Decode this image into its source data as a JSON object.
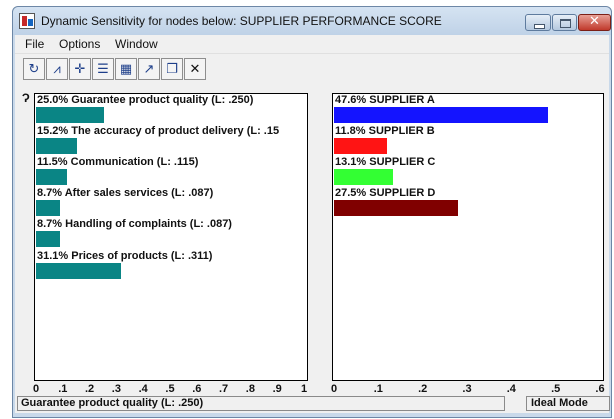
{
  "window": {
    "title": "Dynamic Sensitivity for nodes below: SUPPLIER PERFORMANCE SCORE",
    "close_glyph": "✕"
  },
  "menu": [
    "File",
    "Options",
    "Window"
  ],
  "toolbar": {
    "icons": [
      "refresh-icon",
      "line-graph-icon",
      "gradient-icon",
      "stacked-bars-icon",
      "grid-chart-icon",
      "arrow-icon",
      "windows-icon",
      "close-icon"
    ],
    "glyphs": [
      "↻",
      "⩘",
      "✛",
      "☰",
      "▦",
      "↗",
      "❐",
      "✕"
    ]
  },
  "left_mark": "Ɂ",
  "chart_data": [
    {
      "type": "bar",
      "orientation": "horizontal",
      "categories": [
        "25.0% Guarantee product quality (L: .250)",
        "15.2% The accuracy of product delivery (L: .15",
        "11.5% Communication (L: .115)",
        "8.7% After sales services (L: .087)",
        "8.7% Handling of complaints (L: .087)",
        "31.1% Prices of products (L: .311)"
      ],
      "values": [
        0.25,
        0.152,
        0.115,
        0.087,
        0.087,
        0.311
      ],
      "color": "#0a8585",
      "xlim": [
        0,
        1
      ],
      "xticks": [
        "0",
        ".1",
        ".2",
        ".3",
        ".4",
        ".5",
        ".6",
        ".7",
        ".8",
        ".9",
        "1"
      ]
    },
    {
      "type": "bar",
      "orientation": "horizontal",
      "categories": [
        "47.6% SUPPLIER A",
        "11.8% SUPPLIER B",
        "13.1% SUPPLIER C",
        "27.5% SUPPLIER D"
      ],
      "values": [
        0.476,
        0.118,
        0.131,
        0.275
      ],
      "colors": [
        "#1414ff",
        "#ff1414",
        "#33ff33",
        "#800000"
      ],
      "xlim": [
        0,
        0.6
      ],
      "xticks": [
        "0",
        ".1",
        ".2",
        ".3",
        ".4",
        ".5",
        ".6"
      ]
    }
  ],
  "status": {
    "left": "Guarantee product quality (L: .250)",
    "right": "Ideal Mode"
  }
}
